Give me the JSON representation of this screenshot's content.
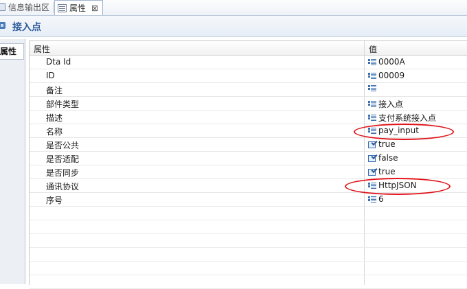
{
  "tabs": {
    "inactive_label": "信息输出区",
    "active_label": "属性",
    "close_glyph": "⊠"
  },
  "titlebar": {
    "title": "接入点"
  },
  "sidebar": {
    "tab_label": "属性"
  },
  "table": {
    "header_property": "属性",
    "header_value": "值",
    "rows": [
      {
        "name": "Dta Id",
        "value": "0000A",
        "icon": "text-icon"
      },
      {
        "name": "ID",
        "value": "00009",
        "icon": "text-icon"
      },
      {
        "name": "备注",
        "value": "",
        "icon": "text-icon"
      },
      {
        "name": "部件类型",
        "value": "接入点",
        "icon": "text-icon"
      },
      {
        "name": "描述",
        "value": "支付系统接入点",
        "icon": "text-icon"
      },
      {
        "name": "名称",
        "value": "pay_input",
        "icon": "text-icon"
      },
      {
        "name": "是否公共",
        "value": "true",
        "icon": "boolean-icon"
      },
      {
        "name": "是否适配",
        "value": "false",
        "icon": "boolean-icon"
      },
      {
        "name": "是否同步",
        "value": "true",
        "icon": "boolean-icon"
      },
      {
        "name": "通讯协议",
        "value": "HttpJSON",
        "icon": "text-icon"
      },
      {
        "name": "序号",
        "value": "6",
        "icon": "text-icon"
      }
    ]
  },
  "colors": {
    "annotation": "#e0141b",
    "title": "#2c5a9a"
  }
}
